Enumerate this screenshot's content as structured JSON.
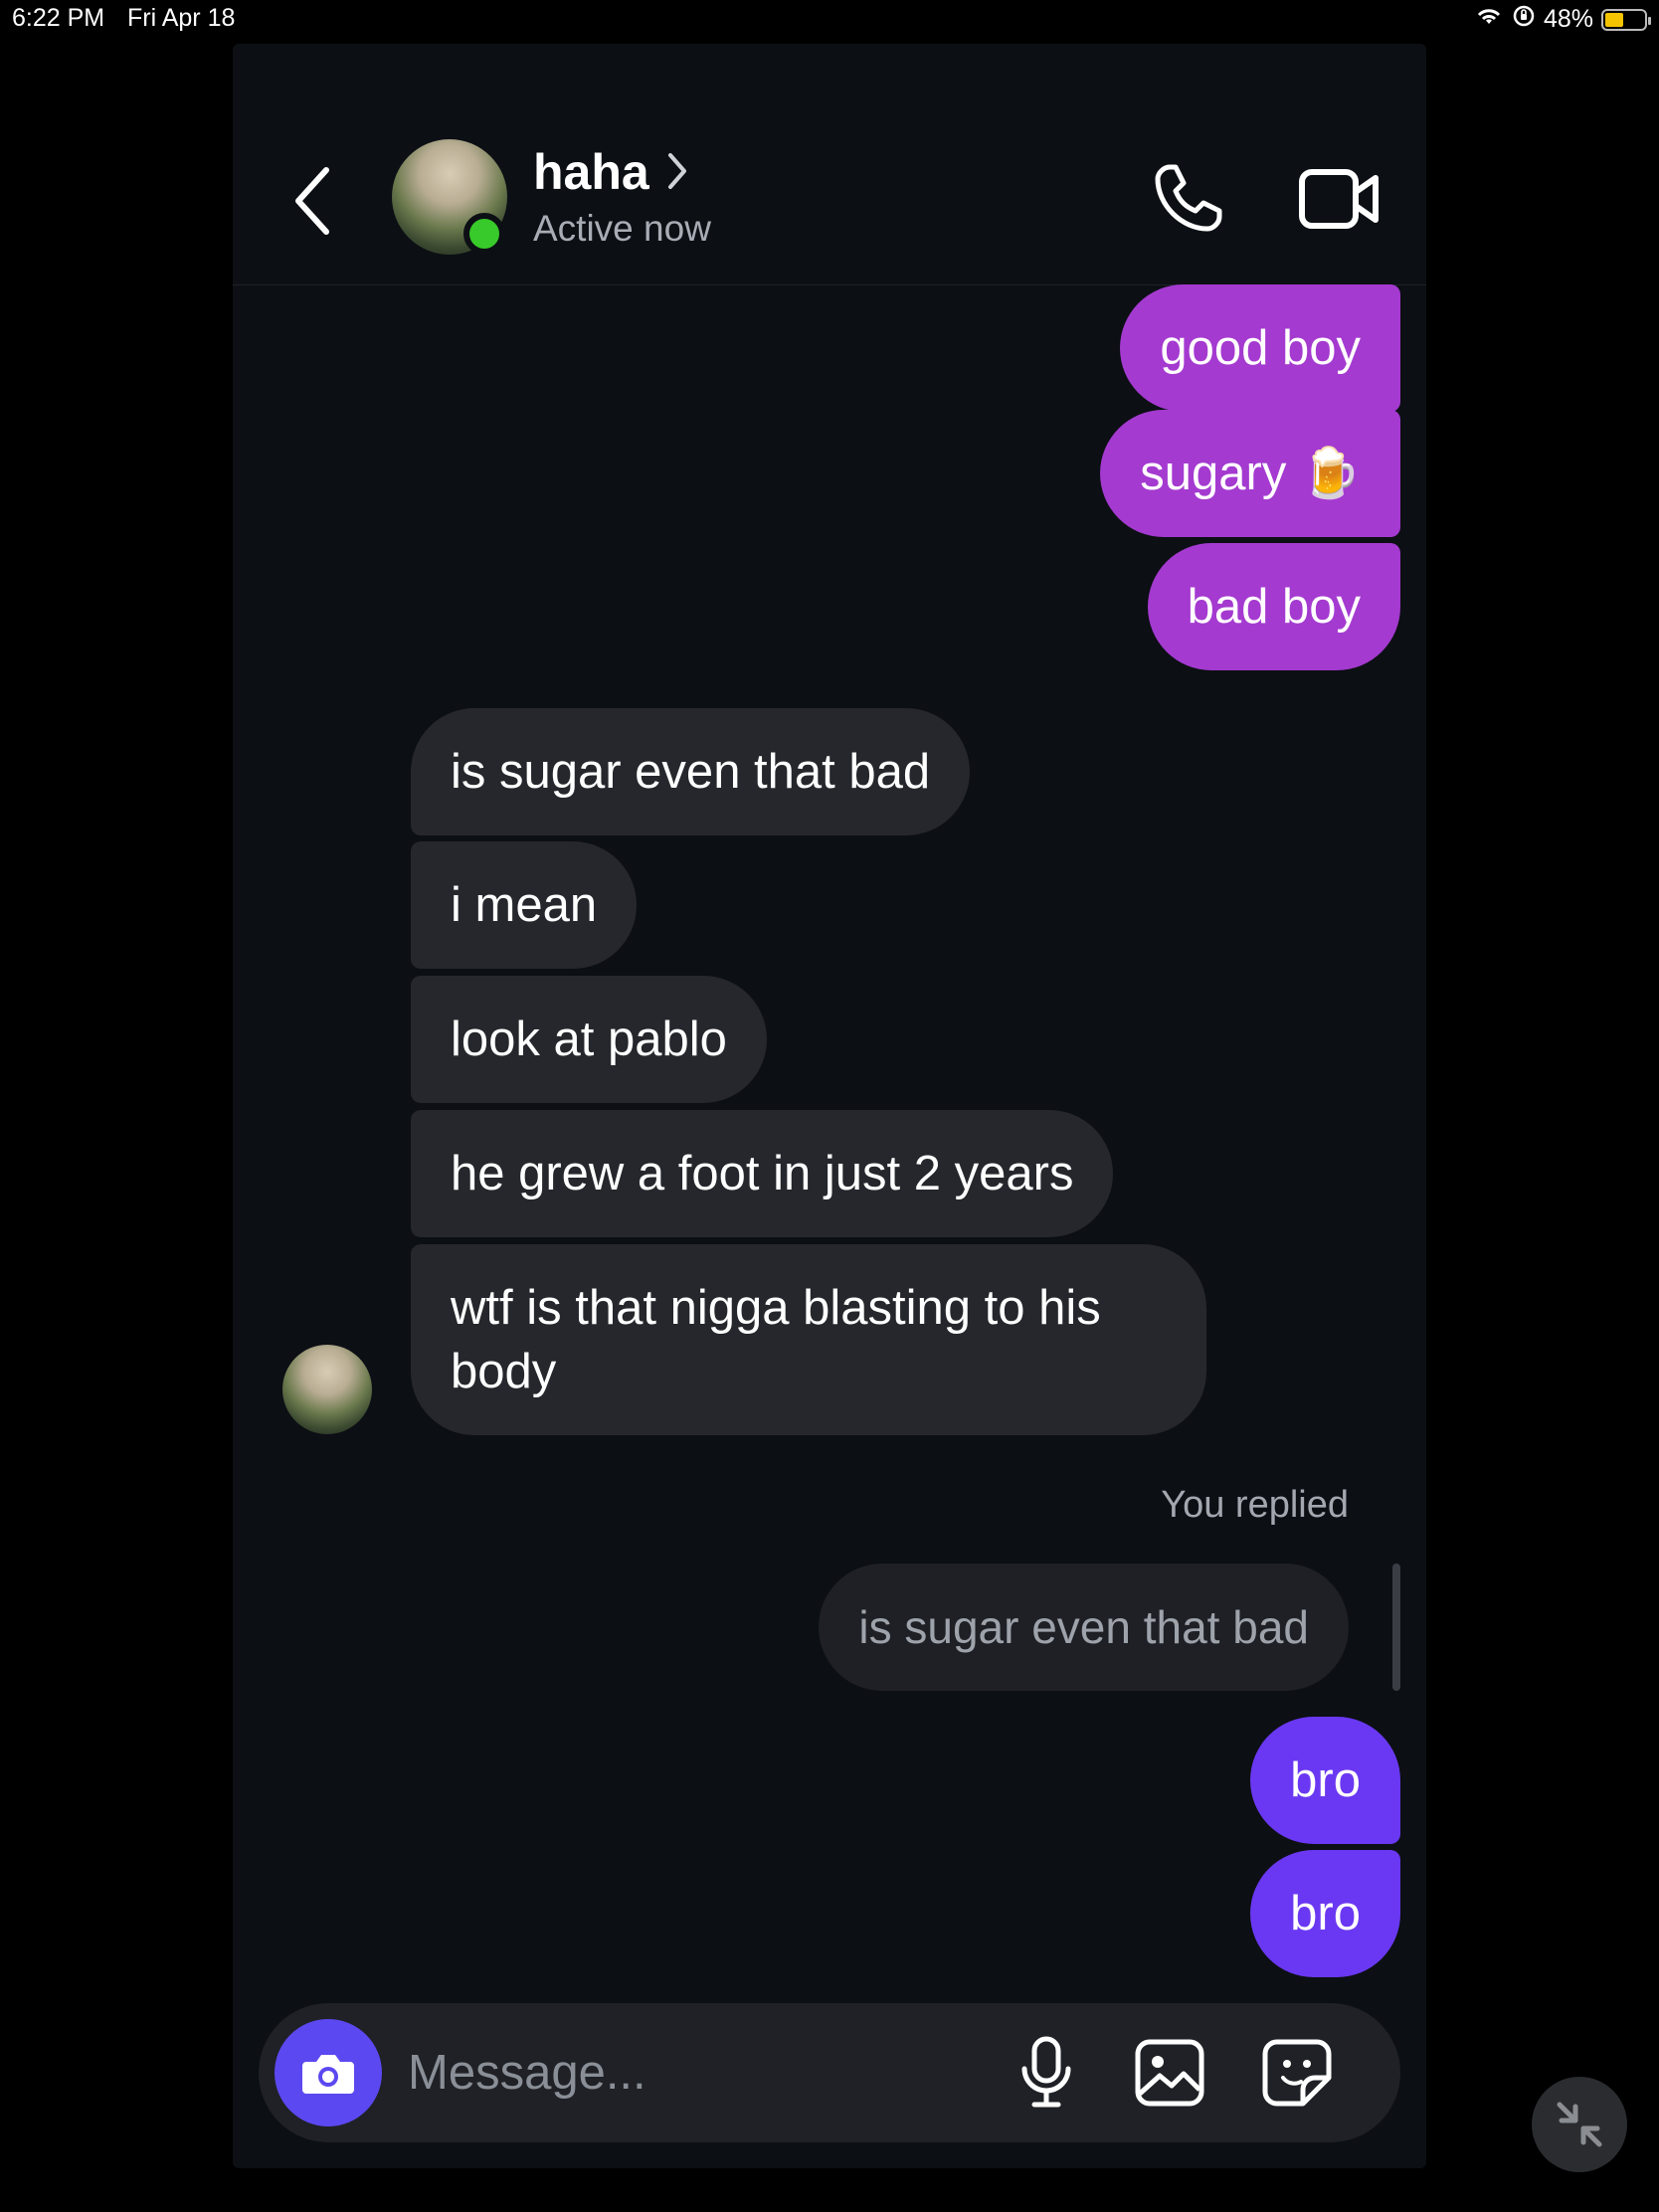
{
  "status_bar": {
    "time": "6:22 PM",
    "date": "Fri Apr 18",
    "battery": "48%",
    "battery_level": 0.48
  },
  "header": {
    "contact_name": "haha",
    "status": "Active now",
    "icons": [
      "back-icon",
      "chevron-right-icon",
      "phone-icon",
      "video-camera-icon"
    ]
  },
  "messages": {
    "outgoing_top": [
      "good boy",
      "sugary 🍺",
      "bad boy"
    ],
    "incoming": [
      "is sugar even that bad",
      "i mean",
      "look at pablo",
      "he grew a foot in just 2 years",
      "wtf is that nigga blasting to his body"
    ],
    "reply": {
      "label": "You replied",
      "quoted_text": "is sugar even that bad"
    },
    "outgoing_bottom": [
      "bro",
      "bro"
    ]
  },
  "composer": {
    "placeholder": "Message...",
    "icons": [
      "camera-icon",
      "microphone-icon",
      "image-icon",
      "sticker-icon"
    ]
  },
  "colors": {
    "background": "#0c0f14",
    "outgoing_purple": "#a43ad0",
    "outgoing_violet": "#6a38f2",
    "incoming_bubble": "#25272c",
    "online": "#38c92a",
    "camera_button": "#5c48f0"
  }
}
